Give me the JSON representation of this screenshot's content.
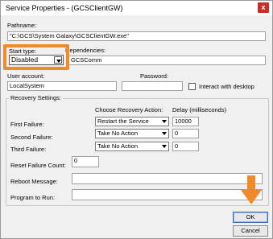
{
  "window": {
    "title": "Service Properties - (GCSClientGW)",
    "close_glyph": "x"
  },
  "pathname": {
    "label": "Pathname:",
    "value": "\"C:\\GCS\\System Galaxy\\GCSClientGW.exe\""
  },
  "start_type": {
    "label": "Start type:",
    "value": "Disabled"
  },
  "dependencies": {
    "label": "Dependencies:",
    "value": "GCSComm"
  },
  "user_account": {
    "label": "User account:",
    "value": "LocalSystem"
  },
  "password": {
    "label": "Password:",
    "value": ""
  },
  "interact": {
    "label": "Interact with desktop",
    "checked": false
  },
  "recovery": {
    "title": "Recovery Settings:",
    "col_action": "Choose Recovery Action:",
    "col_delay": "Delay (milliseconds)",
    "rows": [
      {
        "label": "First Failure:",
        "action": "Restart the Service",
        "delay": "10000"
      },
      {
        "label": "Second Failure:",
        "action": "Take No Action",
        "delay": "0"
      },
      {
        "label": "Third Failure:",
        "action": "Take No Action",
        "delay": "0"
      }
    ],
    "reset_label": "Reset Failure Count:",
    "reset_value": "0",
    "reboot_label": "Reboot Message:",
    "reboot_value": "",
    "program_label": "Program to Run:",
    "program_value": ""
  },
  "buttons": {
    "ok": "OK",
    "cancel": "Cancel"
  },
  "colors": {
    "highlight": "#f08a2b",
    "close": "#c7302a"
  }
}
